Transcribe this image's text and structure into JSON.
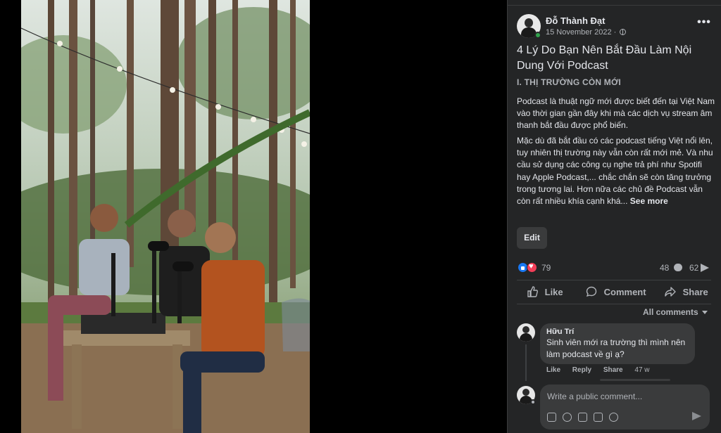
{
  "post": {
    "author": "Đỗ Thành Đạt",
    "date": "15 November 2022 ·",
    "more_label": "•••",
    "title": "4 Lý Do Bạn Nên Bắt Đầu Làm Nội Dung Với Podcast",
    "section_heading": "I. THỊ TRƯỜNG CÒN MỚI",
    "paragraph_1": "Podcast là thuật ngữ mới được biết đến tại Việt Nam vào thời gian gần đây khi mà các dịch vụ stream âm thanh bắt đầu được phổ biến.",
    "paragraph_2": "Mặc dù đã bắt đầu có các podcast tiếng Việt nổi lên, tuy nhiên thị trường này vẫn còn rất mới mẻ. Và nhu cầu sử dụng các công cụ nghe trả phí như Spotifi hay Apple Podcast,... chắc chắn sẽ còn tăng trưởng trong tương lai. Hơn nữa các chủ đề Podcast vẫn còn rất nhiều khía cạnh khá...",
    "see_more": "See more",
    "edit_label": "Edit"
  },
  "stats": {
    "reactions": "79",
    "comments": "48",
    "shares": "62"
  },
  "actions": {
    "like": "Like",
    "comment": "Comment",
    "share": "Share"
  },
  "comments_filter": "All comments",
  "comment": {
    "author": "Hữu Trí",
    "text": "Sinh viên mới ra trường thì mình nên làm podcast về gì ạ?",
    "like": "Like",
    "reply": "Reply",
    "share": "Share",
    "time": "47 w"
  },
  "composer": {
    "placeholder": "Write a public comment..."
  },
  "icons": [
    "globe-icon",
    "like-reaction-icon",
    "love-reaction-icon",
    "comment-bubble-icon",
    "share-arrow-icon",
    "thumbs-up-icon",
    "comment-icon",
    "share-icon",
    "caret-down-icon",
    "sticker-icon",
    "emoji-icon",
    "camera-icon",
    "gif-icon",
    "avatar-sticker-icon",
    "send-icon"
  ]
}
